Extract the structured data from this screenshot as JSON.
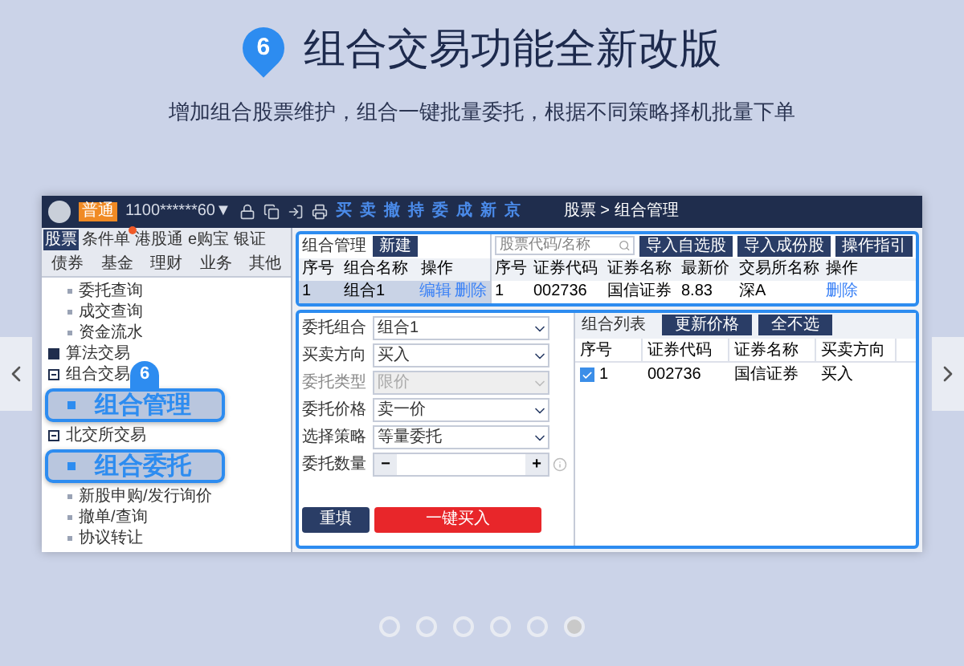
{
  "slide": {
    "badge": "6",
    "title": "组合交易功能全新改版",
    "subtitle": "增加组合股票维护，组合一键批量委托，根据不同策略择机批量下单"
  },
  "app": {
    "account": {
      "level_badge": "普通",
      "id": "1100******60▼"
    },
    "quick_actions": [
      "买",
      "卖",
      "撤",
      "持",
      "委",
      "成",
      "新",
      "京"
    ],
    "breadcrumb": "股票 > 组合管理",
    "nav_tabs": [
      {
        "label": "股票",
        "selected": true,
        "alert": false
      },
      {
        "label": "条件单",
        "selected": false,
        "alert": true
      },
      {
        "label": "港股通",
        "selected": false,
        "alert": false
      },
      {
        "label": "e购宝",
        "selected": false,
        "alert": false
      },
      {
        "label": "银证",
        "selected": false,
        "alert": false
      }
    ],
    "nav_tabs_2": [
      {
        "label": "债券",
        "selected": false
      },
      {
        "label": "基金",
        "selected": false
      },
      {
        "label": "理财",
        "selected": false
      },
      {
        "label": "业务",
        "selected": false
      },
      {
        "label": "其他",
        "selected": false
      }
    ],
    "step_badge": "6",
    "tree": [
      {
        "label": "委托查询",
        "kind": "leaf"
      },
      {
        "label": "成交查询",
        "kind": "leaf"
      },
      {
        "label": "资金流水",
        "kind": "leaf"
      },
      {
        "label": "算法交易",
        "kind": "group",
        "expanded": false
      },
      {
        "label": "组合交易",
        "kind": "group",
        "expanded": true,
        "children": [
          {
            "label": "组合管理",
            "kind": "callout"
          }
        ]
      },
      {
        "label": "北交所交易",
        "kind": "group",
        "expanded": true,
        "children": [
          {
            "label": "组合委托",
            "kind": "callout"
          },
          {
            "label": "新股申购/发行询价",
            "kind": "leaf"
          },
          {
            "label": "撤单/查询",
            "kind": "leaf"
          },
          {
            "label": "协议转让",
            "kind": "leaf"
          }
        ]
      }
    ],
    "portfolios": {
      "title": "组合管理",
      "new_button": "新建",
      "columns": [
        "序号",
        "组合名称",
        "操作"
      ],
      "rows": [
        {
          "cells": [
            "1",
            "组合1"
          ],
          "actions": [
            "编辑",
            "删除"
          ],
          "selected": true
        }
      ]
    },
    "stocks": {
      "search_placeholder": "股票代码/名称",
      "buttons": [
        "导入自选股",
        "导入成份股",
        "操作指引"
      ],
      "columns": [
        "序号",
        "证券代码",
        "证券名称",
        "最新价",
        "交易所名称",
        "操作"
      ],
      "rows": [
        {
          "cells": [
            "1",
            "002736",
            "国信证券",
            "8.83",
            "深A"
          ],
          "actions": [
            "删除"
          ]
        }
      ]
    },
    "order_form": {
      "fields": [
        {
          "label": "委托组合",
          "kind": "select",
          "value": "组合1",
          "disabled": false
        },
        {
          "label": "买卖方向",
          "kind": "select",
          "value": "买入",
          "disabled": false
        },
        {
          "label": "委托类型",
          "kind": "select",
          "value": "限价",
          "disabled": true
        },
        {
          "label": "委托价格",
          "kind": "select",
          "value": "卖一价",
          "disabled": false
        },
        {
          "label": "选择策略",
          "kind": "select",
          "value": "等量委托",
          "disabled": false
        },
        {
          "label": "委托数量",
          "kind": "stepper",
          "minus": "−",
          "plus": "+"
        }
      ],
      "reset_button": "重填",
      "submit_button": "一键买入"
    },
    "portfolio_list": {
      "title": "组合列表",
      "buttons": [
        "更新价格",
        "全不选"
      ],
      "columns": [
        "序号",
        "证券代码",
        "证券名称",
        "买卖方向"
      ],
      "rows": [
        {
          "cells": [
            "1",
            "002736",
            "国信证券",
            "买入"
          ],
          "checked": true
        }
      ]
    }
  },
  "carousel": {
    "dots": [
      {
        "selected": false
      },
      {
        "selected": false
      },
      {
        "selected": false
      },
      {
        "selected": false
      },
      {
        "selected": false
      },
      {
        "selected": true
      }
    ]
  }
}
